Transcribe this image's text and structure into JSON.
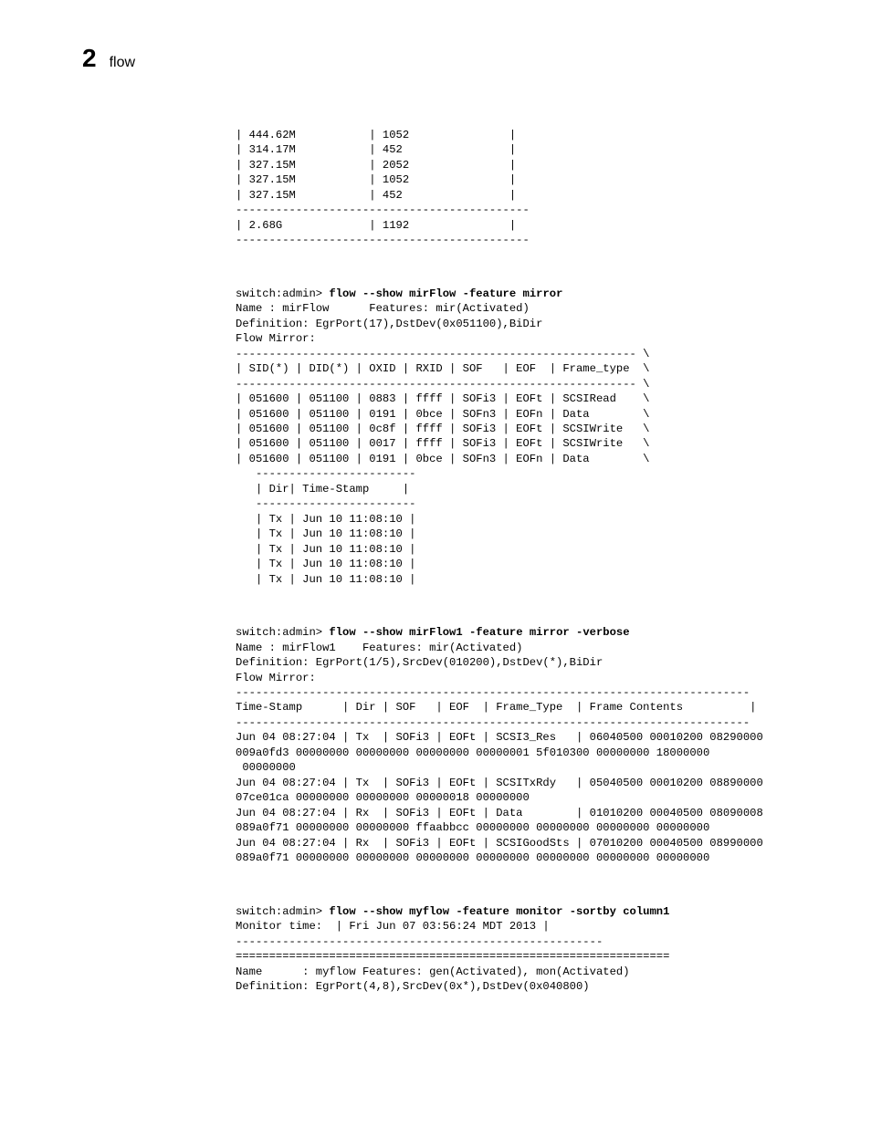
{
  "header": {
    "chapter_num": "2",
    "title": "flow"
  },
  "blocks": {
    "small_table": "| 444.62M           | 1052               |\n| 314.17M           | 452                |\n| 327.15M           | 2052               |\n| 327.15M           | 1052               |\n| 327.15M           | 452                |\n--------------------------------------------\n| 2.68G             | 1192               |\n--------------------------------------------",
    "cmd1_prompt": "switch:admin> ",
    "cmd1_command": "flow --show mirFlow -feature mirror",
    "cmd1_body": "Name : mirFlow      Features: mir(Activated)\nDefinition: EgrPort(17),DstDev(0x051100),BiDir\nFlow Mirror:\n------------------------------------------------------------ \\\n| SID(*) | DID(*) | OXID | RXID | SOF   | EOF  | Frame_type  \\\n------------------------------------------------------------ \\\n| 051600 | 051100 | 0883 | ffff | SOFi3 | EOFt | SCSIRead    \\\n| 051600 | 051100 | 0191 | 0bce | SOFn3 | EOFn | Data        \\\n| 051600 | 051100 | 0c8f | ffff | SOFi3 | EOFt | SCSIWrite   \\\n| 051600 | 051100 | 0017 | ffff | SOFi3 | EOFt | SCSIWrite   \\\n| 051600 | 051100 | 0191 | 0bce | SOFn3 | EOFn | Data        \\\n   ------------------------\n   | Dir| Time-Stamp     |\n   ------------------------\n   | Tx | Jun 10 11:08:10 |\n   | Tx | Jun 10 11:08:10 |\n   | Tx | Jun 10 11:08:10 |\n   | Tx | Jun 10 11:08:10 |\n   | Tx | Jun 10 11:08:10 |",
    "cmd2_prompt": "switch:admin> ",
    "cmd2_command": "flow --show mirFlow1 -feature mirror -verbose",
    "cmd2_body": "Name : mirFlow1    Features: mir(Activated)\nDefinition: EgrPort(1/5),SrcDev(010200),DstDev(*),BiDir\nFlow Mirror:\n-----------------------------------------------------------------------------\nTime-Stamp      | Dir | SOF   | EOF  | Frame_Type  | Frame Contents          |\n-----------------------------------------------------------------------------\nJun 04 08:27:04 | Tx  | SOFi3 | EOFt | SCSI3_Res   | 06040500 00010200 08290000\n009a0fd3 00000000 00000000 00000000 00000001 5f010300 00000000 18000000\n 00000000\nJun 04 08:27:04 | Tx  | SOFi3 | EOFt | SCSITxRdy   | 05040500 00010200 08890000\n07ce01ca 00000000 00000000 00000018 00000000\nJun 04 08:27:04 | Rx  | SOFi3 | EOFt | Data        | 01010200 00040500 08090008\n089a0f71 00000000 00000000 ffaabbcc 00000000 00000000 00000000 00000000\nJun 04 08:27:04 | Rx  | SOFi3 | EOFt | SCSIGoodSts | 07010200 00040500 08990000\n089a0f71 00000000 00000000 00000000 00000000 00000000 00000000 00000000",
    "cmd3_prompt": "switch:admin> ",
    "cmd3_command": "flow --show myflow -feature monitor -sortby column1",
    "cmd3_body": "Monitor time:  | Fri Jun 07 03:56:24 MDT 2013 |\n-------------------------------------------------------\n=================================================================\nName      : myflow Features: gen(Activated), mon(Activated)\nDefinition: EgrPort(4,8),SrcDev(0x*),DstDev(0x040800)"
  }
}
